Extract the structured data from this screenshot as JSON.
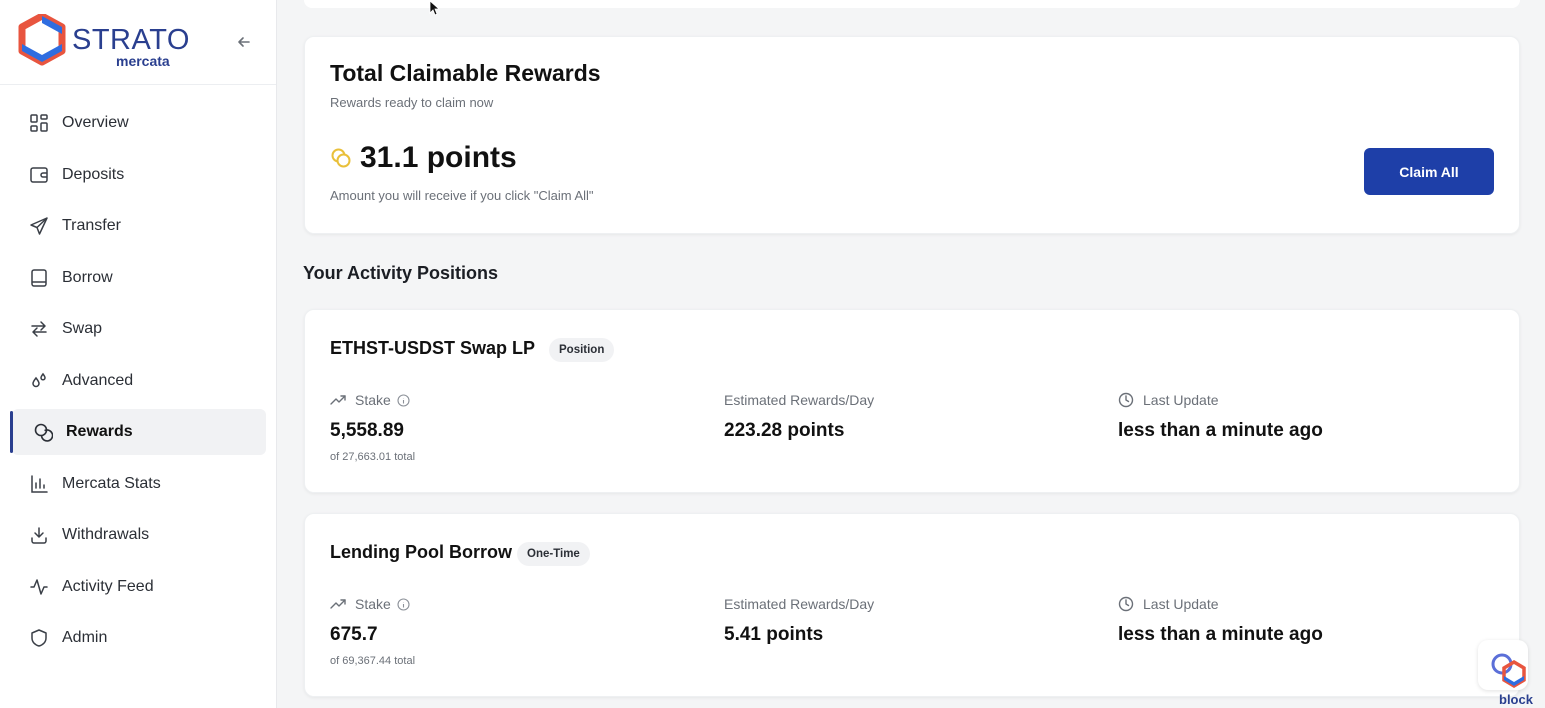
{
  "brand": {
    "name": "STRATO",
    "sub": "mercata"
  },
  "sidebar": {
    "items": [
      {
        "label": "Overview",
        "icon": "grid-icon"
      },
      {
        "label": "Deposits",
        "icon": "wallet-icon"
      },
      {
        "label": "Transfer",
        "icon": "send-icon"
      },
      {
        "label": "Borrow",
        "icon": "book-icon"
      },
      {
        "label": "Swap",
        "icon": "swap-arrows-icon"
      },
      {
        "label": "Advanced",
        "icon": "drops-icon"
      },
      {
        "label": "Rewards",
        "icon": "coins-icon",
        "active": true
      },
      {
        "label": "Mercata Stats",
        "icon": "bar-chart-icon"
      },
      {
        "label": "Withdrawals",
        "icon": "download-icon"
      },
      {
        "label": "Activity Feed",
        "icon": "activity-icon"
      },
      {
        "label": "Admin",
        "icon": "shield-icon"
      }
    ]
  },
  "claim": {
    "title": "Total Claimable Rewards",
    "subtitle": "Rewards ready to claim now",
    "points": "31.1 points",
    "note": "Amount you will receive if you click \"Claim All\"",
    "button": "Claim All"
  },
  "positions_title": "Your Activity Positions",
  "positions": [
    {
      "name": "ETHST-USDST Swap LP",
      "badge": "Position",
      "stake_label": "Stake",
      "stake_value": "5,558.89",
      "stake_total": "of 27,663.01 total",
      "rewards_label": "Estimated Rewards/Day",
      "rewards_value": "223.28 points",
      "update_label": "Last Update",
      "update_value": "less than a minute ago"
    },
    {
      "name": "Lending Pool Borrow",
      "badge": "One-Time",
      "stake_label": "Stake",
      "stake_value": "675.7",
      "stake_total": "of 69,367.44 total",
      "rewards_label": "Estimated Rewards/Day",
      "rewards_value": "5.41 points",
      "update_label": "Last Update",
      "update_value": "less than a minute ago"
    }
  ],
  "widget": {
    "label": "block"
  },
  "colors": {
    "brand": "#2a3f8f",
    "button": "#1e3fa8",
    "logo_red": "#e8553f",
    "coin": "#e9c03a"
  }
}
